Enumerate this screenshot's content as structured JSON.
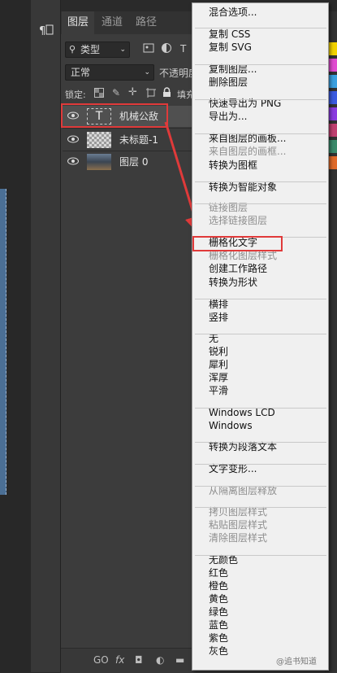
{
  "app": {
    "collapse_arrow": "‹‹",
    "panel_tabs": [
      {
        "label": "图层"
      },
      {
        "label": "通道"
      },
      {
        "label": "路径"
      }
    ],
    "filter": {
      "label": "类型",
      "icon": "search-icon"
    },
    "blend_mode": "正常",
    "opacity_label": "不透明度",
    "lock_label": "锁定:",
    "fill_label": "填充",
    "layers": [
      {
        "name": "机械公敌",
        "type": "text",
        "thumb_text": "T",
        "eye": "●",
        "selected": true
      },
      {
        "name": "未标题-1",
        "type": "transparent",
        "eye": "●",
        "selected": false
      },
      {
        "name": "图层 0",
        "type": "image",
        "eye": "●",
        "selected": false
      }
    ],
    "bottom_icons": [
      "GO",
      "fx",
      "◘",
      "◐",
      "▬"
    ]
  },
  "context_menu": {
    "groups": [
      [
        {
          "label": "混合选项...",
          "disabled": false
        }
      ],
      [
        {
          "label": "复制 CSS",
          "disabled": false
        },
        {
          "label": "复制 SVG",
          "disabled": false
        }
      ],
      [
        {
          "label": "复制图层...",
          "disabled": false
        },
        {
          "label": "删除图层",
          "disabled": false
        }
      ],
      [
        {
          "label": "快速导出为 PNG",
          "disabled": false
        },
        {
          "label": "导出为...",
          "disabled": false
        }
      ],
      [
        {
          "label": "来自图层的画板...",
          "disabled": false
        },
        {
          "label": "来自图层的画框...",
          "disabled": true
        },
        {
          "label": "转换为图框",
          "disabled": false
        }
      ],
      [
        {
          "label": "转换为智能对象",
          "disabled": false
        }
      ],
      [
        {
          "label": "链接图层",
          "disabled": true
        },
        {
          "label": "选择链接图层",
          "disabled": true
        }
      ],
      [
        {
          "label": "栅格化文字",
          "disabled": false,
          "highlighted": true
        },
        {
          "label": "栅格化图层样式",
          "disabled": true
        },
        {
          "label": "创建工作路径",
          "disabled": false
        },
        {
          "label": "转换为形状",
          "disabled": false
        }
      ],
      [
        {
          "label": "横排",
          "disabled": false
        },
        {
          "label": "竖排",
          "disabled": false
        }
      ],
      [
        {
          "label": "无",
          "disabled": false
        },
        {
          "label": "锐利",
          "disabled": false
        },
        {
          "label": "犀利",
          "disabled": false
        },
        {
          "label": "浑厚",
          "disabled": false
        },
        {
          "label": "平滑",
          "disabled": false
        }
      ],
      [
        {
          "label": "Windows LCD",
          "disabled": false
        },
        {
          "label": "Windows",
          "disabled": false
        }
      ],
      [
        {
          "label": "转换为段落文本",
          "disabled": false
        }
      ],
      [
        {
          "label": "文字变形...",
          "disabled": false
        }
      ],
      [
        {
          "label": "从隔离图层释放",
          "disabled": true
        }
      ],
      [
        {
          "label": "拷贝图层样式",
          "disabled": true
        },
        {
          "label": "粘贴图层样式",
          "disabled": true
        },
        {
          "label": "清除图层样式",
          "disabled": true
        }
      ],
      [
        {
          "label": "无颜色",
          "disabled": false
        },
        {
          "label": "红色",
          "disabled": false
        },
        {
          "label": "橙色",
          "disabled": false
        },
        {
          "label": "黄色",
          "disabled": false
        },
        {
          "label": "绿色",
          "disabled": false
        },
        {
          "label": "蓝色",
          "disabled": false
        },
        {
          "label": "紫色",
          "disabled": false
        },
        {
          "label": "灰色",
          "disabled": false
        }
      ]
    ]
  },
  "colors": {
    "highlight_red": "#e03a3a",
    "menu_bg": "#f0f0f0",
    "panel_bg": "#3c3c3c",
    "swatches": [
      "#f2d200",
      "#e04ad0",
      "#3aa0e0",
      "#3a5ae0",
      "#8a3ae0",
      "#c04070",
      "#3a8a6a",
      "#e06a2a"
    ]
  },
  "watermark": "@追书知道"
}
